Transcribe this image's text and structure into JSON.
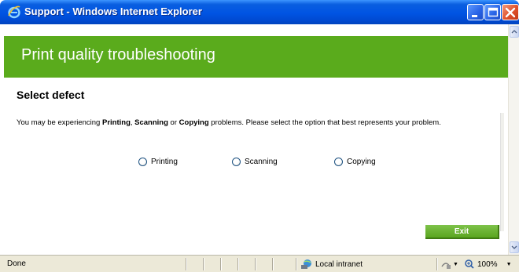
{
  "window": {
    "title": "Support - Windows Internet Explorer"
  },
  "page": {
    "header_title": "Print quality troubleshooting",
    "section_title": "Select defect",
    "instructions": {
      "t1": "You may be experiencing ",
      "b1": "Printing",
      "t2": ", ",
      "b2": "Scanning",
      "t3": " or ",
      "b3": "Copying",
      "t4": " problems. Please select the option that best represents your problem."
    },
    "options": [
      {
        "label": "Printing"
      },
      {
        "label": "Scanning"
      },
      {
        "label": "Copying"
      }
    ],
    "exit_label": "Exit"
  },
  "status": {
    "text": "Done",
    "zone": "Local intranet",
    "zoom": "100%"
  },
  "colors": {
    "header_green": "#5aab1c",
    "titlebar_blue": "#0054e3"
  },
  "icons": [
    "ie-logo-icon",
    "minimize-icon",
    "maximize-icon",
    "close-icon",
    "intranet-zone-icon",
    "protected-mode-icon",
    "zoom-icon"
  ]
}
